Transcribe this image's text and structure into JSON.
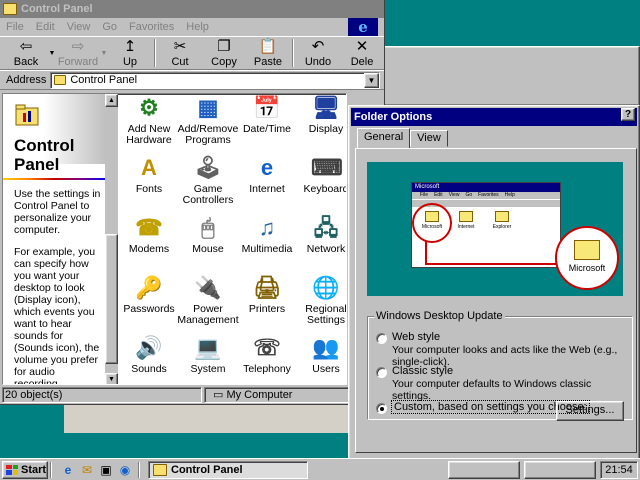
{
  "control_panel": {
    "title": "Control Panel",
    "menu": [
      "File",
      "Edit",
      "View",
      "Go",
      "Favorites",
      "Help"
    ],
    "toolbar": [
      {
        "label": "Back",
        "icon": "back-arrow-icon",
        "glyph": "⇦",
        "enabled": true
      },
      {
        "label": "Forward",
        "icon": "forward-arrow-icon",
        "glyph": "⇨",
        "enabled": false
      },
      {
        "label": "Up",
        "icon": "up-folder-icon",
        "glyph": "↥",
        "enabled": true
      },
      {
        "label": "Cut",
        "icon": "scissors-icon",
        "glyph": "✂",
        "enabled": true
      },
      {
        "label": "Copy",
        "icon": "copy-icon",
        "glyph": "❐",
        "enabled": true
      },
      {
        "label": "Paste",
        "icon": "paste-icon",
        "glyph": "📋",
        "enabled": true
      },
      {
        "label": "Undo",
        "icon": "undo-icon",
        "glyph": "↶",
        "enabled": true
      },
      {
        "label": "Dele",
        "icon": "delete-x-icon",
        "glyph": "✕",
        "enabled": true
      }
    ],
    "address_label": "Address",
    "address_value": "Control Panel",
    "left_pane": {
      "title": "Control Panel",
      "paragraph1": "Use the settings in Control Panel to personalize your computer.",
      "paragraph2": "For example, you can specify how you want your desktop to look (Display icon), which events you want to hear sounds for (Sounds icon), the volume you prefer for audio recording"
    },
    "items": [
      {
        "label": "Add New Hardware",
        "icon": "add-hardware-icon",
        "glyph": "⚙"
      },
      {
        "label": "Add/Remove Programs",
        "icon": "add-remove-programs-icon",
        "glyph": "▦"
      },
      {
        "label": "Date/Time",
        "icon": "calendar-clock-icon",
        "glyph": "📅"
      },
      {
        "label": "Display",
        "icon": "monitor-icon",
        "glyph": "🖥"
      },
      {
        "label": "Fonts",
        "icon": "fonts-folder-icon",
        "glyph": "A"
      },
      {
        "label": "Game Controllers",
        "icon": "joystick-icon",
        "glyph": "🕹"
      },
      {
        "label": "Internet",
        "icon": "internet-globe-icon",
        "glyph": "e"
      },
      {
        "label": "Keyboard",
        "icon": "keyboard-icon",
        "glyph": "⌨"
      },
      {
        "label": "Modems",
        "icon": "telephone-modem-icon",
        "glyph": "☎"
      },
      {
        "label": "Mouse",
        "icon": "mouse-icon",
        "glyph": "🖱"
      },
      {
        "label": "Multimedia",
        "icon": "multimedia-icon",
        "glyph": "♫"
      },
      {
        "label": "Network",
        "icon": "network-icon",
        "glyph": "🖧"
      },
      {
        "label": "Passwords",
        "icon": "keys-icon",
        "glyph": "🔑"
      },
      {
        "label": "Power Management",
        "icon": "power-icon",
        "glyph": "🔌"
      },
      {
        "label": "Printers",
        "icon": "printer-folder-icon",
        "glyph": "🖨"
      },
      {
        "label": "Regional Settings",
        "icon": "globe-icon",
        "glyph": "🌐"
      },
      {
        "label": "Sounds",
        "icon": "speaker-icon",
        "glyph": "🔊"
      },
      {
        "label": "System",
        "icon": "computer-icon",
        "glyph": "💻"
      },
      {
        "label": "Telephony",
        "icon": "telephony-icon",
        "glyph": "☏"
      },
      {
        "label": "Users",
        "icon": "users-icon",
        "glyph": "👥"
      }
    ],
    "status_left": "20 object(s)",
    "status_right": "My Computer"
  },
  "folder_options": {
    "title": "Folder Options",
    "help": "?",
    "tabs": [
      "General",
      "View"
    ],
    "preview": {
      "mini_title": "Microsoft",
      "mini_menu": [
        "File",
        "Edit",
        "View",
        "Go",
        "Favorites",
        "Help"
      ],
      "folders": [
        "Microsoft",
        "Internet",
        "Explorer"
      ],
      "zoom_label": "Microsoft"
    },
    "group_label": "Windows Desktop Update",
    "options": [
      {
        "label": "Web style",
        "desc": "Your computer looks and acts like the Web (e.g., single-click).",
        "selected": false
      },
      {
        "label": "Classic style",
        "desc": "Your computer defaults to Windows classic settings.",
        "selected": false
      },
      {
        "label": "Custom, based on settings you choose:",
        "desc": "",
        "selected": true
      }
    ],
    "settings_button": "Settings..."
  },
  "taskbar": {
    "start": "Start",
    "task": "Control Panel",
    "clock": "21:54"
  }
}
